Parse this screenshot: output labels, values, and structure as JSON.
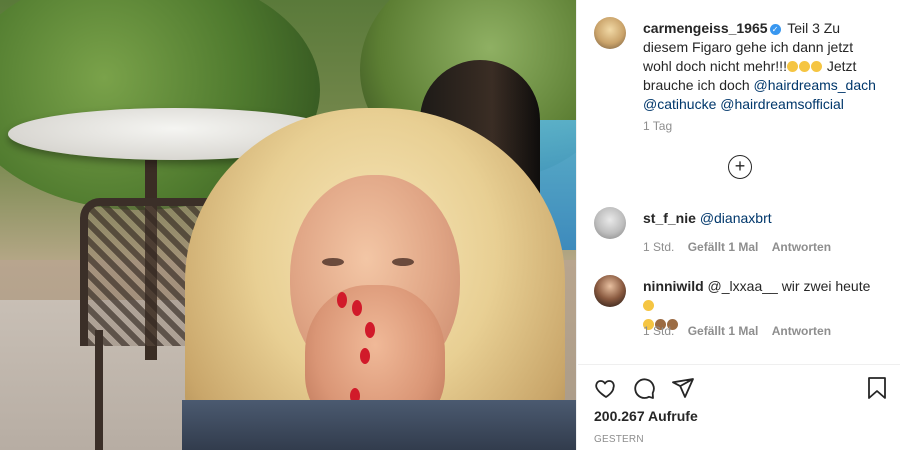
{
  "post": {
    "username": "carmengeiss_1965",
    "caption_text": "Teil 3 Zu diesem Figaro gehe ich dann jetzt wohl doch nicht mehr!!!",
    "caption_cont": "Jetzt brauche ich doch",
    "mentions": [
      "@hairdreams_dach",
      "@catihucke",
      "@hairdreamsofficial"
    ],
    "time": "1 Tag"
  },
  "comments": [
    {
      "username": "st_f_nie",
      "text": "@dianaxbrt",
      "time": "1 Std.",
      "likes": "Gefällt 1 Mal",
      "reply": "Antworten"
    },
    {
      "username": "ninniwild",
      "text": "@_lxxaa__ wir zwei heute",
      "time": "1 Std.",
      "likes": "Gefällt 1 Mal",
      "reply": "Antworten"
    }
  ],
  "actions": {
    "views": "200.267 Aufrufe",
    "date": "GESTERN"
  },
  "icons": [
    "verified-badge-icon",
    "plus-circle-icon",
    "heart-icon",
    "comment-icon",
    "share-icon",
    "bookmark-icon"
  ],
  "colors": {
    "link": "#00376b",
    "verified": "#3897f0",
    "muted": "#8e8e8e"
  }
}
